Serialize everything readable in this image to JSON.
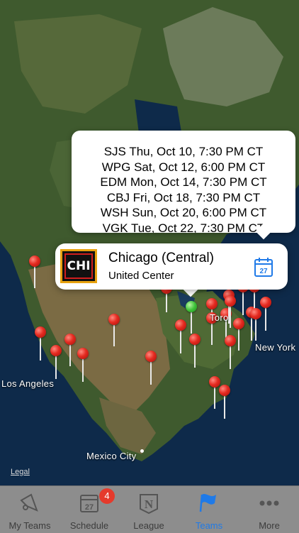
{
  "map": {
    "labels": {
      "toronto": "Toro",
      "new_york": "New York",
      "los_angeles": "Los Angeles",
      "mexico_city": "Mexico City"
    },
    "legal": "Legal"
  },
  "schedule_popup": {
    "games": [
      "SJS Thu, Oct 10, 7:30 PM CT",
      "WPG Sat, Oct 12, 6:00 PM CT",
      "EDM Mon, Oct 14, 7:30 PM CT",
      "CBJ Fri, Oct 18, 7:30 PM CT",
      "WSH Sun, Oct 20, 6:00 PM CT",
      "VGK Tue, Oct 22, 7:30 PM CT"
    ]
  },
  "callout": {
    "logo_text": "CHI",
    "team_name": "Chicago (Central)",
    "venue": "United Center",
    "calendar_icon_number": "27",
    "icon": "calendar-icon"
  },
  "tabbar": {
    "tabs": [
      {
        "label": "My Teams",
        "icon": "megaphone-icon",
        "active": false
      },
      {
        "label": "Schedule",
        "icon": "calendar-icon",
        "active": false,
        "badge": "4",
        "icon_number": "27"
      },
      {
        "label": "League",
        "icon": "league-logo-icon",
        "active": false,
        "icon_text": "N"
      },
      {
        "label": "Teams",
        "icon": "flag-icon",
        "active": true
      },
      {
        "label": "More",
        "icon": "more-dots-icon",
        "active": false
      }
    ]
  },
  "colors": {
    "pin": "#e52b21",
    "selected_pin": "#3fc43a",
    "tab_active": "#1f7ae8",
    "tabbar_bg": "#8d8d8d"
  }
}
